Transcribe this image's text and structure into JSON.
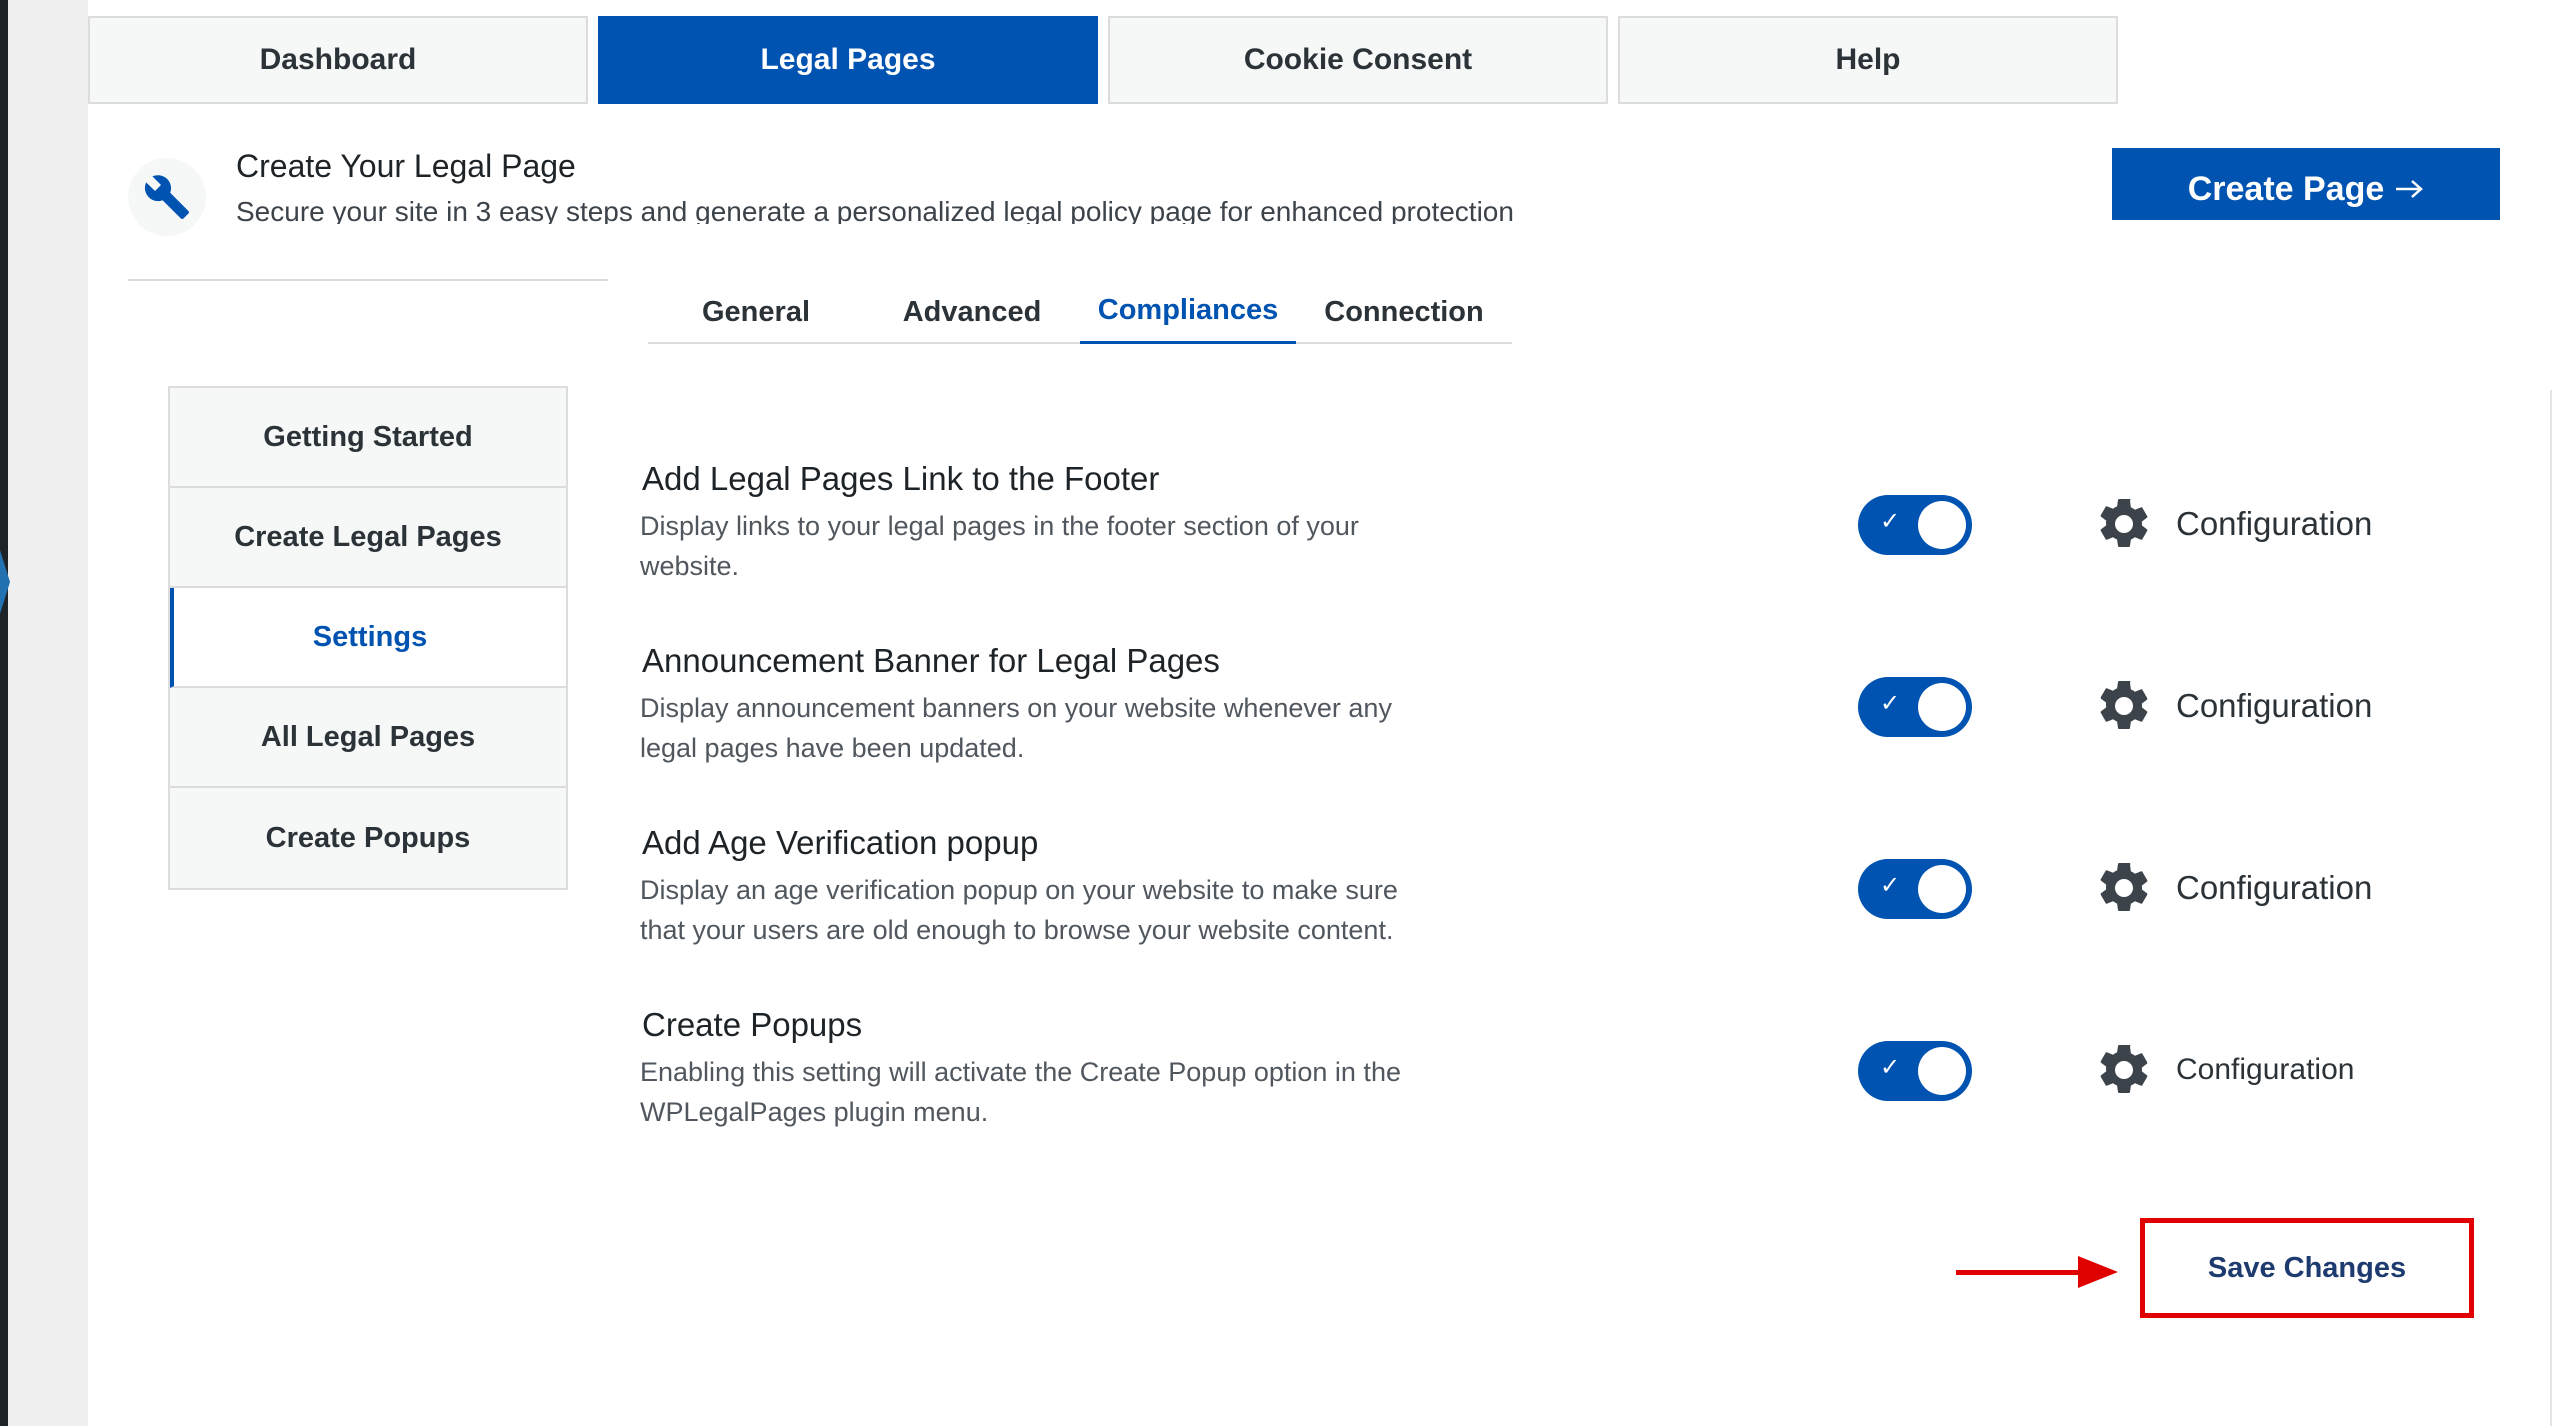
{
  "top_tabs": [
    {
      "label": "Dashboard",
      "active": false
    },
    {
      "label": "Legal Pages",
      "active": true
    },
    {
      "label": "Cookie Consent",
      "active": false
    },
    {
      "label": "Help",
      "active": false
    }
  ],
  "header": {
    "icon": "wrench-icon",
    "title": "Create Your Legal Page",
    "subtitle": "Secure your site in 3 easy steps and generate a personalized legal policy page for enhanced protection",
    "create_button": "Create Page",
    "create_button_icon": "arrow-right-icon"
  },
  "sub_tabs": [
    {
      "label": "General",
      "active": false
    },
    {
      "label": "Advanced",
      "active": false
    },
    {
      "label": "Compliances",
      "active": true
    },
    {
      "label": "Connection",
      "active": false
    }
  ],
  "side_menu": [
    {
      "label": "Getting Started",
      "active": false
    },
    {
      "label": "Create Legal Pages",
      "active": false
    },
    {
      "label": "Settings",
      "active": true
    },
    {
      "label": "All Legal Pages",
      "active": false
    },
    {
      "label": "Create Popups",
      "active": false
    }
  ],
  "settings": [
    {
      "title": "Add Legal Pages Link to the Footer",
      "description": "Display links to your legal pages in the footer section of your website.",
      "enabled": true,
      "config_label": "Configuration"
    },
    {
      "title": "Announcement Banner for Legal Pages",
      "description": "Display announcement banners on your website whenever any legal pages have been updated.",
      "enabled": true,
      "config_label": "Configuration"
    },
    {
      "title": "Add Age Verification popup",
      "description": "Display an age verification popup on your website to make sure that your users are old enough to browse your website content.",
      "enabled": true,
      "config_label": "Configuration"
    },
    {
      "title": "Create Popups",
      "description": "Enabling this setting will activate the Create Popup option in the WPLegalPages plugin menu.",
      "enabled": true,
      "config_label": "Configuration"
    }
  ],
  "toggle_check": "✓",
  "save_button": "Save Changes",
  "colors": {
    "primary": "#0053b0",
    "highlight": "#e00000"
  }
}
